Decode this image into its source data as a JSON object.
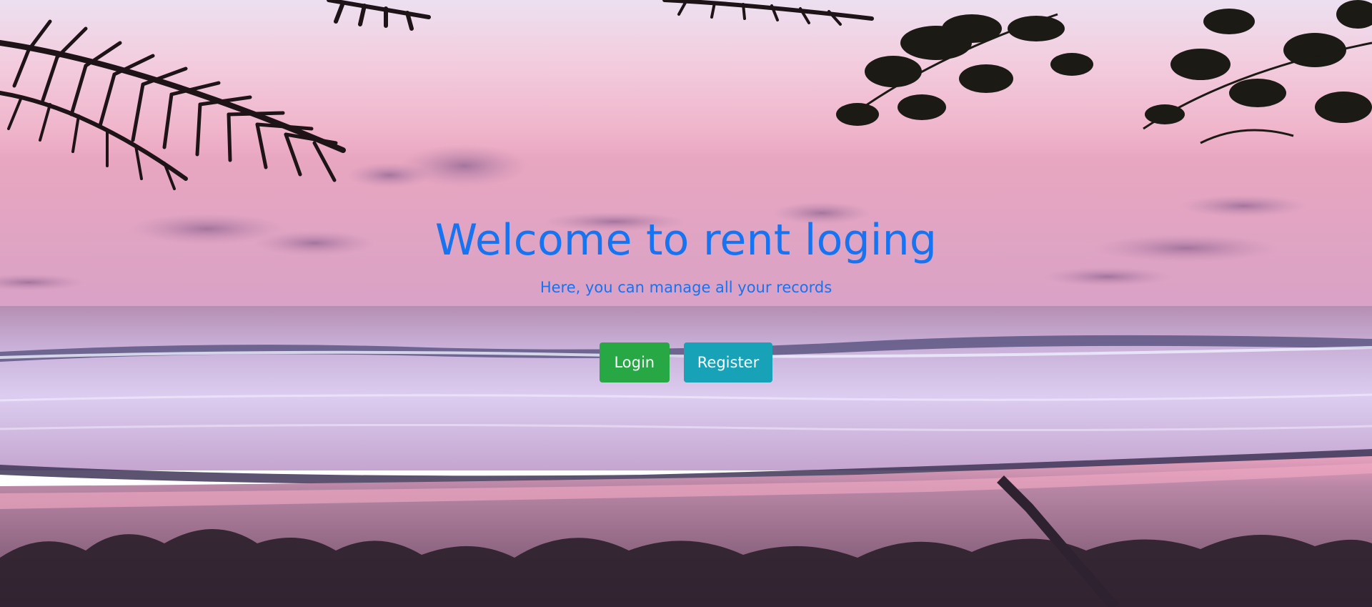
{
  "hero": {
    "title": "Welcome to rent loging",
    "subtitle": "Here, you can manage all your records"
  },
  "actions": {
    "login_label": "Login",
    "register_label": "Register"
  },
  "colors": {
    "title": "#1673f2",
    "login_button": "#28a745",
    "register_button": "#17a2b8"
  }
}
